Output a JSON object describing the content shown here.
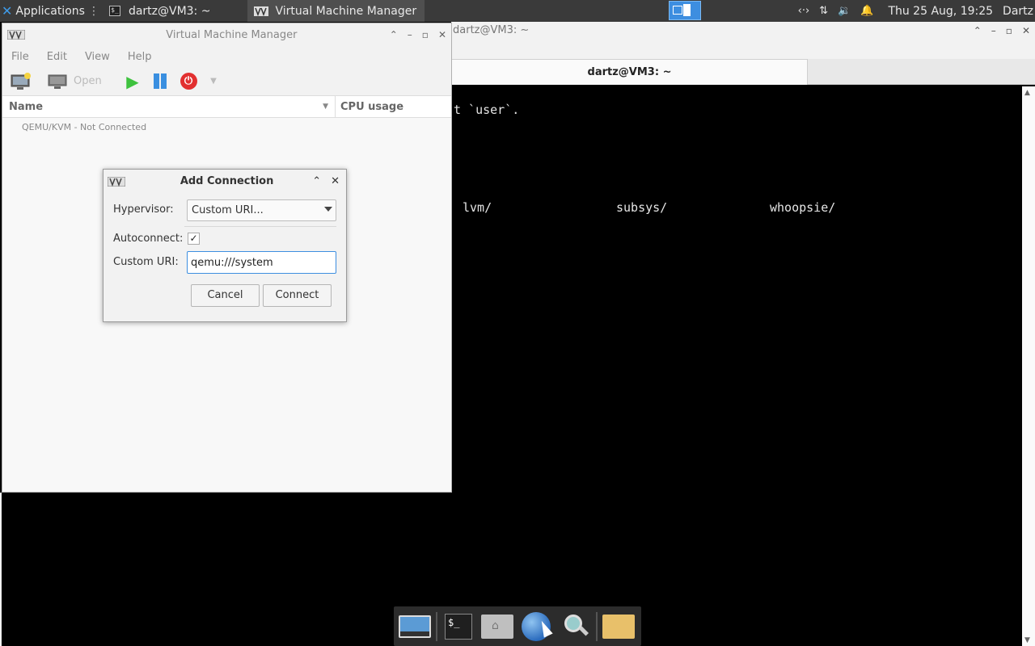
{
  "top_panel": {
    "applications_label": "Applications",
    "tasks": [
      {
        "label": "dartz@VM3: ~",
        "icon": "terminal-icon"
      },
      {
        "label": "Virtual Machine Manager",
        "icon": "vmm-icon"
      }
    ],
    "clock": "Thu 25 Aug, 19:25",
    "user": "Dartz"
  },
  "terminal": {
    "window_title": "dartz@VM3: ~",
    "tab_label": "dartz@VM3: ~",
    "lines": [
      {
        "text": "t `user`."
      },
      {
        "text": "lvm/"
      },
      {
        "text": "subsys/"
      },
      {
        "text": "whoopsie/"
      }
    ]
  },
  "vmm": {
    "title": "Virtual Machine Manager",
    "menu": [
      "File",
      "Edit",
      "View",
      "Help"
    ],
    "toolbar": {
      "open_label": "Open"
    },
    "columns": {
      "name": "Name",
      "cpu": "CPU usage"
    },
    "rows": [
      "QEMU/KVM - Not Connected"
    ]
  },
  "dialog": {
    "title": "Add Connection",
    "hypervisor_label": "Hypervisor:",
    "hypervisor_value": "Custom URI...",
    "autoconnect_label": "Autoconnect:",
    "autoconnect_checked": true,
    "check_mark": "✓",
    "custom_uri_label": "Custom URI:",
    "custom_uri_value": "qemu:///system",
    "cancel_label": "Cancel",
    "connect_label": "Connect"
  },
  "colors": {
    "accent": "#3d8ee0",
    "run_green": "#3ec23e",
    "power_red": "#e23030",
    "panel_bg": "#3a3a3a"
  }
}
